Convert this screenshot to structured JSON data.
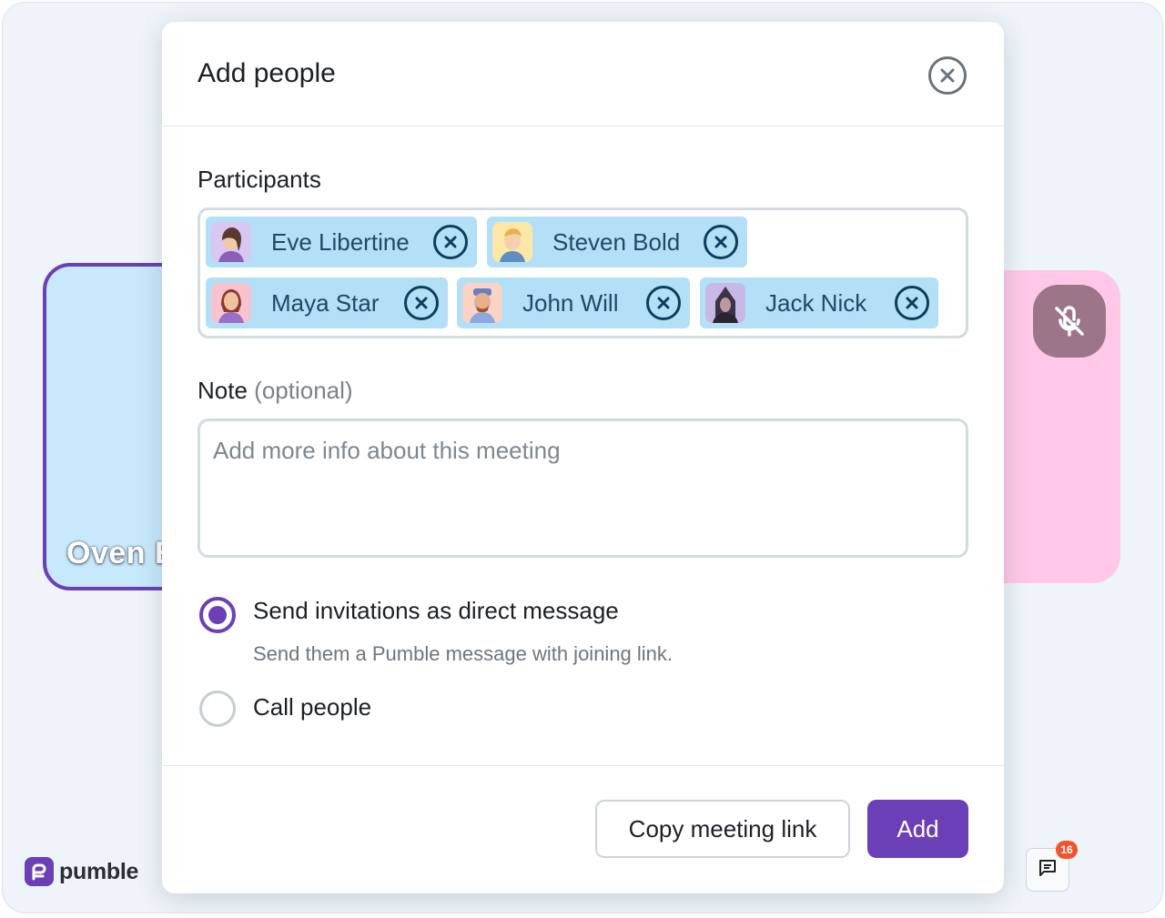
{
  "background": {
    "left_tile_name": "Oven E",
    "brand": {
      "name": "pumble",
      "color": "#6b3fb5"
    },
    "chat_unread_count": "16",
    "right_tile_icon": "mic-off-icon"
  },
  "dialog": {
    "title": "Add people",
    "close_icon": "close-circle-icon",
    "participants_label": "Participants",
    "participants": [
      {
        "name": "Eve Libertine",
        "avatar_bg": "#d9c7f2"
      },
      {
        "name": "Steven Bold",
        "avatar_bg": "#fde7a8"
      },
      {
        "name": "Maya Star",
        "avatar_bg": "#f6c3cf"
      },
      {
        "name": "John Will",
        "avatar_bg": "#f9d4c4"
      },
      {
        "name": "Jack Nick",
        "avatar_bg": "#c9b8e6"
      }
    ],
    "note_label": "Note",
    "note_optional": "(optional)",
    "note_placeholder": "Add more info about this meeting",
    "options": [
      {
        "label": "Send invitations as direct message",
        "description": "Send them a Pumble message with joining link.",
        "selected": true
      },
      {
        "label": "Call people",
        "selected": false
      }
    ],
    "copy_button": "Copy meeting link",
    "add_button": "Add",
    "accent_color": "#6b3fb5",
    "chip_color": "#b3e0f6"
  }
}
